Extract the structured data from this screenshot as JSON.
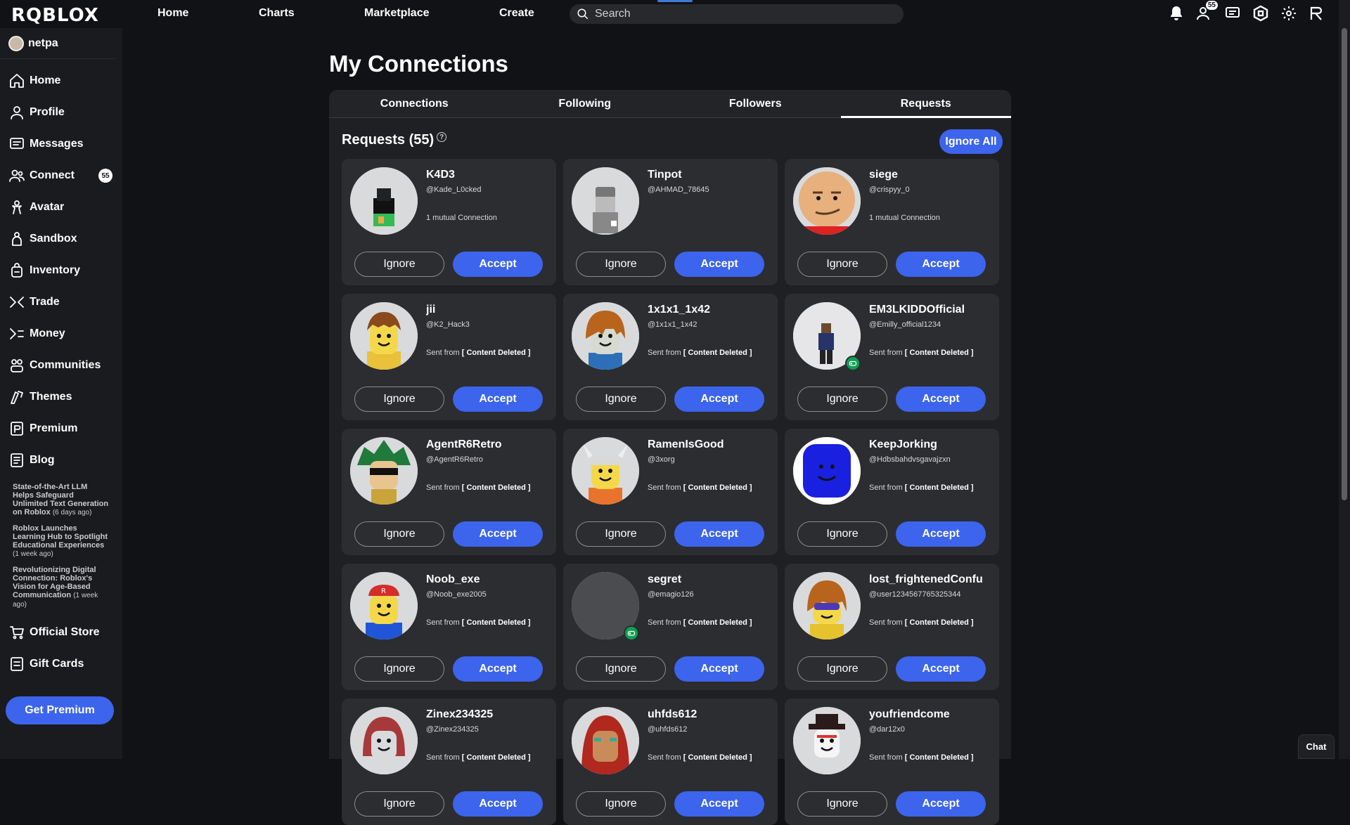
{
  "app": {
    "logo": "RQBLOX",
    "colors": {
      "accent": "#3c64ec",
      "bg": "#111216",
      "card": "#2b2d31"
    }
  },
  "topnav": {
    "home": "Home",
    "charts": "Charts",
    "marketplace": "Marketplace",
    "create": "Create"
  },
  "search": {
    "placeholder": "Search"
  },
  "top_icons": {
    "friends_badge": "55"
  },
  "sidebar": {
    "username": "netpa",
    "items": [
      {
        "label": "Home",
        "icon": "home-icon"
      },
      {
        "label": "Profile",
        "icon": "profile-icon"
      },
      {
        "label": "Messages",
        "icon": "messages-icon"
      },
      {
        "label": "Connect",
        "icon": "connect-icon",
        "badge": "55"
      },
      {
        "label": "Avatar",
        "icon": "avatar-icon"
      },
      {
        "label": "Sandbox",
        "icon": "sandbox-icon"
      },
      {
        "label": "Inventory",
        "icon": "inventory-icon"
      },
      {
        "label": "Trade",
        "icon": "trade-icon"
      },
      {
        "label": "Money",
        "icon": "money-icon"
      },
      {
        "label": "Communities",
        "icon": "communities-icon"
      },
      {
        "label": "Themes",
        "icon": "themes-icon"
      },
      {
        "label": "Premium",
        "icon": "premium-icon"
      },
      {
        "label": "Blog",
        "icon": "blog-icon"
      }
    ],
    "blog_posts": [
      {
        "title": "State-of-the-Art LLM Helps Safeguard Unlimited Text Generation on Roblox",
        "when": "(6 days ago)"
      },
      {
        "title": "Roblox Launches Learning Hub to Spotlight Educational Experiences",
        "when": "(1 week ago)"
      },
      {
        "title": "Revolutionizing Digital Connection: Roblox's Vision for Age-Based Communication",
        "when": "(1 week ago)"
      }
    ],
    "bottom_items": [
      {
        "label": "Official Store",
        "icon": "store-icon"
      },
      {
        "label": "Gift Cards",
        "icon": "gift-card-icon"
      }
    ],
    "get_premium": "Get Premium"
  },
  "page": {
    "title": "My Connections",
    "tabs": [
      "Connections",
      "Following",
      "Followers",
      "Requests"
    ],
    "active_tab": "Requests",
    "requests_heading": "Requests (55)",
    "ignore_all": "Ignore All",
    "ignore_label": "Ignore",
    "accept_label": "Accept",
    "sent_prefix": "Sent from",
    "deleted_label": "[ Content Deleted ]"
  },
  "requests": [
    {
      "name": "K4D3",
      "handle": "@Kade_L0cked",
      "meta": "1 mutual Connection",
      "avatar": "dark",
      "game": false
    },
    {
      "name": "Tinpot",
      "handle": "@AHMAD_78645",
      "meta": "",
      "avatar": "grey",
      "game": false
    },
    {
      "name": "siege",
      "handle": "@crispyy_0",
      "meta": "1 mutual Connection",
      "avatar": "face",
      "game": false
    },
    {
      "name": "jii",
      "handle": "@K2_Hack3",
      "meta": "sent",
      "avatar": "noob-brown",
      "game": false
    },
    {
      "name": "1x1x1_1x42",
      "handle": "@1x1x1_1x42",
      "meta": "sent",
      "avatar": "noob-orange",
      "game": false
    },
    {
      "name": "EM3LKIDDOfficial",
      "handle": "@Emilly_official1234",
      "meta": "sent",
      "avatar": "figure",
      "game": true
    },
    {
      "name": "AgentR6Retro",
      "handle": "@AgentR6Retro",
      "meta": "sent",
      "avatar": "green-hair",
      "game": false
    },
    {
      "name": "RamenIsGood",
      "handle": "@3xorg",
      "meta": "sent",
      "avatar": "viking",
      "game": false
    },
    {
      "name": "KeepJorking",
      "handle": "@Hdbsbahdvsgavajzxn",
      "meta": "sent",
      "avatar": "blue",
      "game": false
    },
    {
      "name": "Noob_exe",
      "handle": "@Noob_exe2005",
      "meta": "sent",
      "avatar": "noob-cap",
      "game": false
    },
    {
      "name": "segret",
      "handle": "@emagio126",
      "meta": "sent",
      "avatar": "empty",
      "game": true
    },
    {
      "name": "lost_frightenedConfu",
      "handle": "@user1234567765325344",
      "meta": "sent",
      "avatar": "noob-shades",
      "game": false
    },
    {
      "name": "Zinex234325",
      "handle": "@Zinex234325",
      "meta": "sent",
      "avatar": "brown-hair",
      "game": false
    },
    {
      "name": "uhfds612",
      "handle": "@uhfds612",
      "meta": "sent",
      "avatar": "red-hair",
      "game": false
    },
    {
      "name": "youfriendcome",
      "handle": "@dar12x0",
      "meta": "sent",
      "avatar": "hat",
      "game": false
    }
  ],
  "chat": "Chat"
}
